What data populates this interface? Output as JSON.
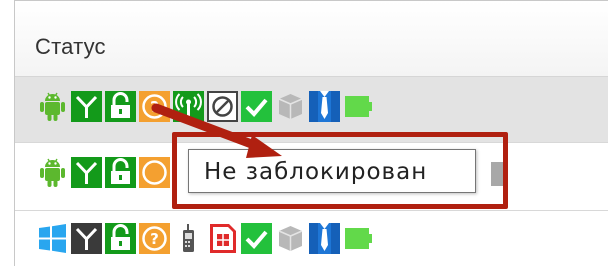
{
  "table": {
    "header": {
      "label": "Статус"
    },
    "rows": [
      {
        "icons": [
          "android-icon",
          "antenna-icon",
          "lock-open-icon",
          "question-icon",
          "wireless-icon",
          "blocked-circle-icon",
          "check-icon",
          "gray-box-icon",
          "person-tie-icon",
          "battery-full-icon"
        ]
      },
      {
        "icons": [
          "android-icon",
          "antenna-icon",
          "lock-open-icon",
          "question-icon",
          "battery-icon"
        ]
      },
      {
        "icons": [
          "windows-icon",
          "antenna-icon",
          "lock-open-icon",
          "question-icon",
          "phone-icon",
          "sim-card-icon",
          "check-icon",
          "gray-box-icon",
          "person-tie-icon",
          "battery-full-icon"
        ]
      }
    ]
  },
  "tooltip": {
    "text": "Не заблокирован"
  },
  "colors": {
    "android_green": "#5cb82e",
    "dark_green": "#139a1a",
    "orange": "#f4a030",
    "check_green": "#23c13c",
    "blue": "#1e76d6",
    "battery_green": "#62d94a",
    "highlight_red": "#b02010",
    "windows_blue": "#29a6ef",
    "sim_red": "#e02a2a"
  }
}
